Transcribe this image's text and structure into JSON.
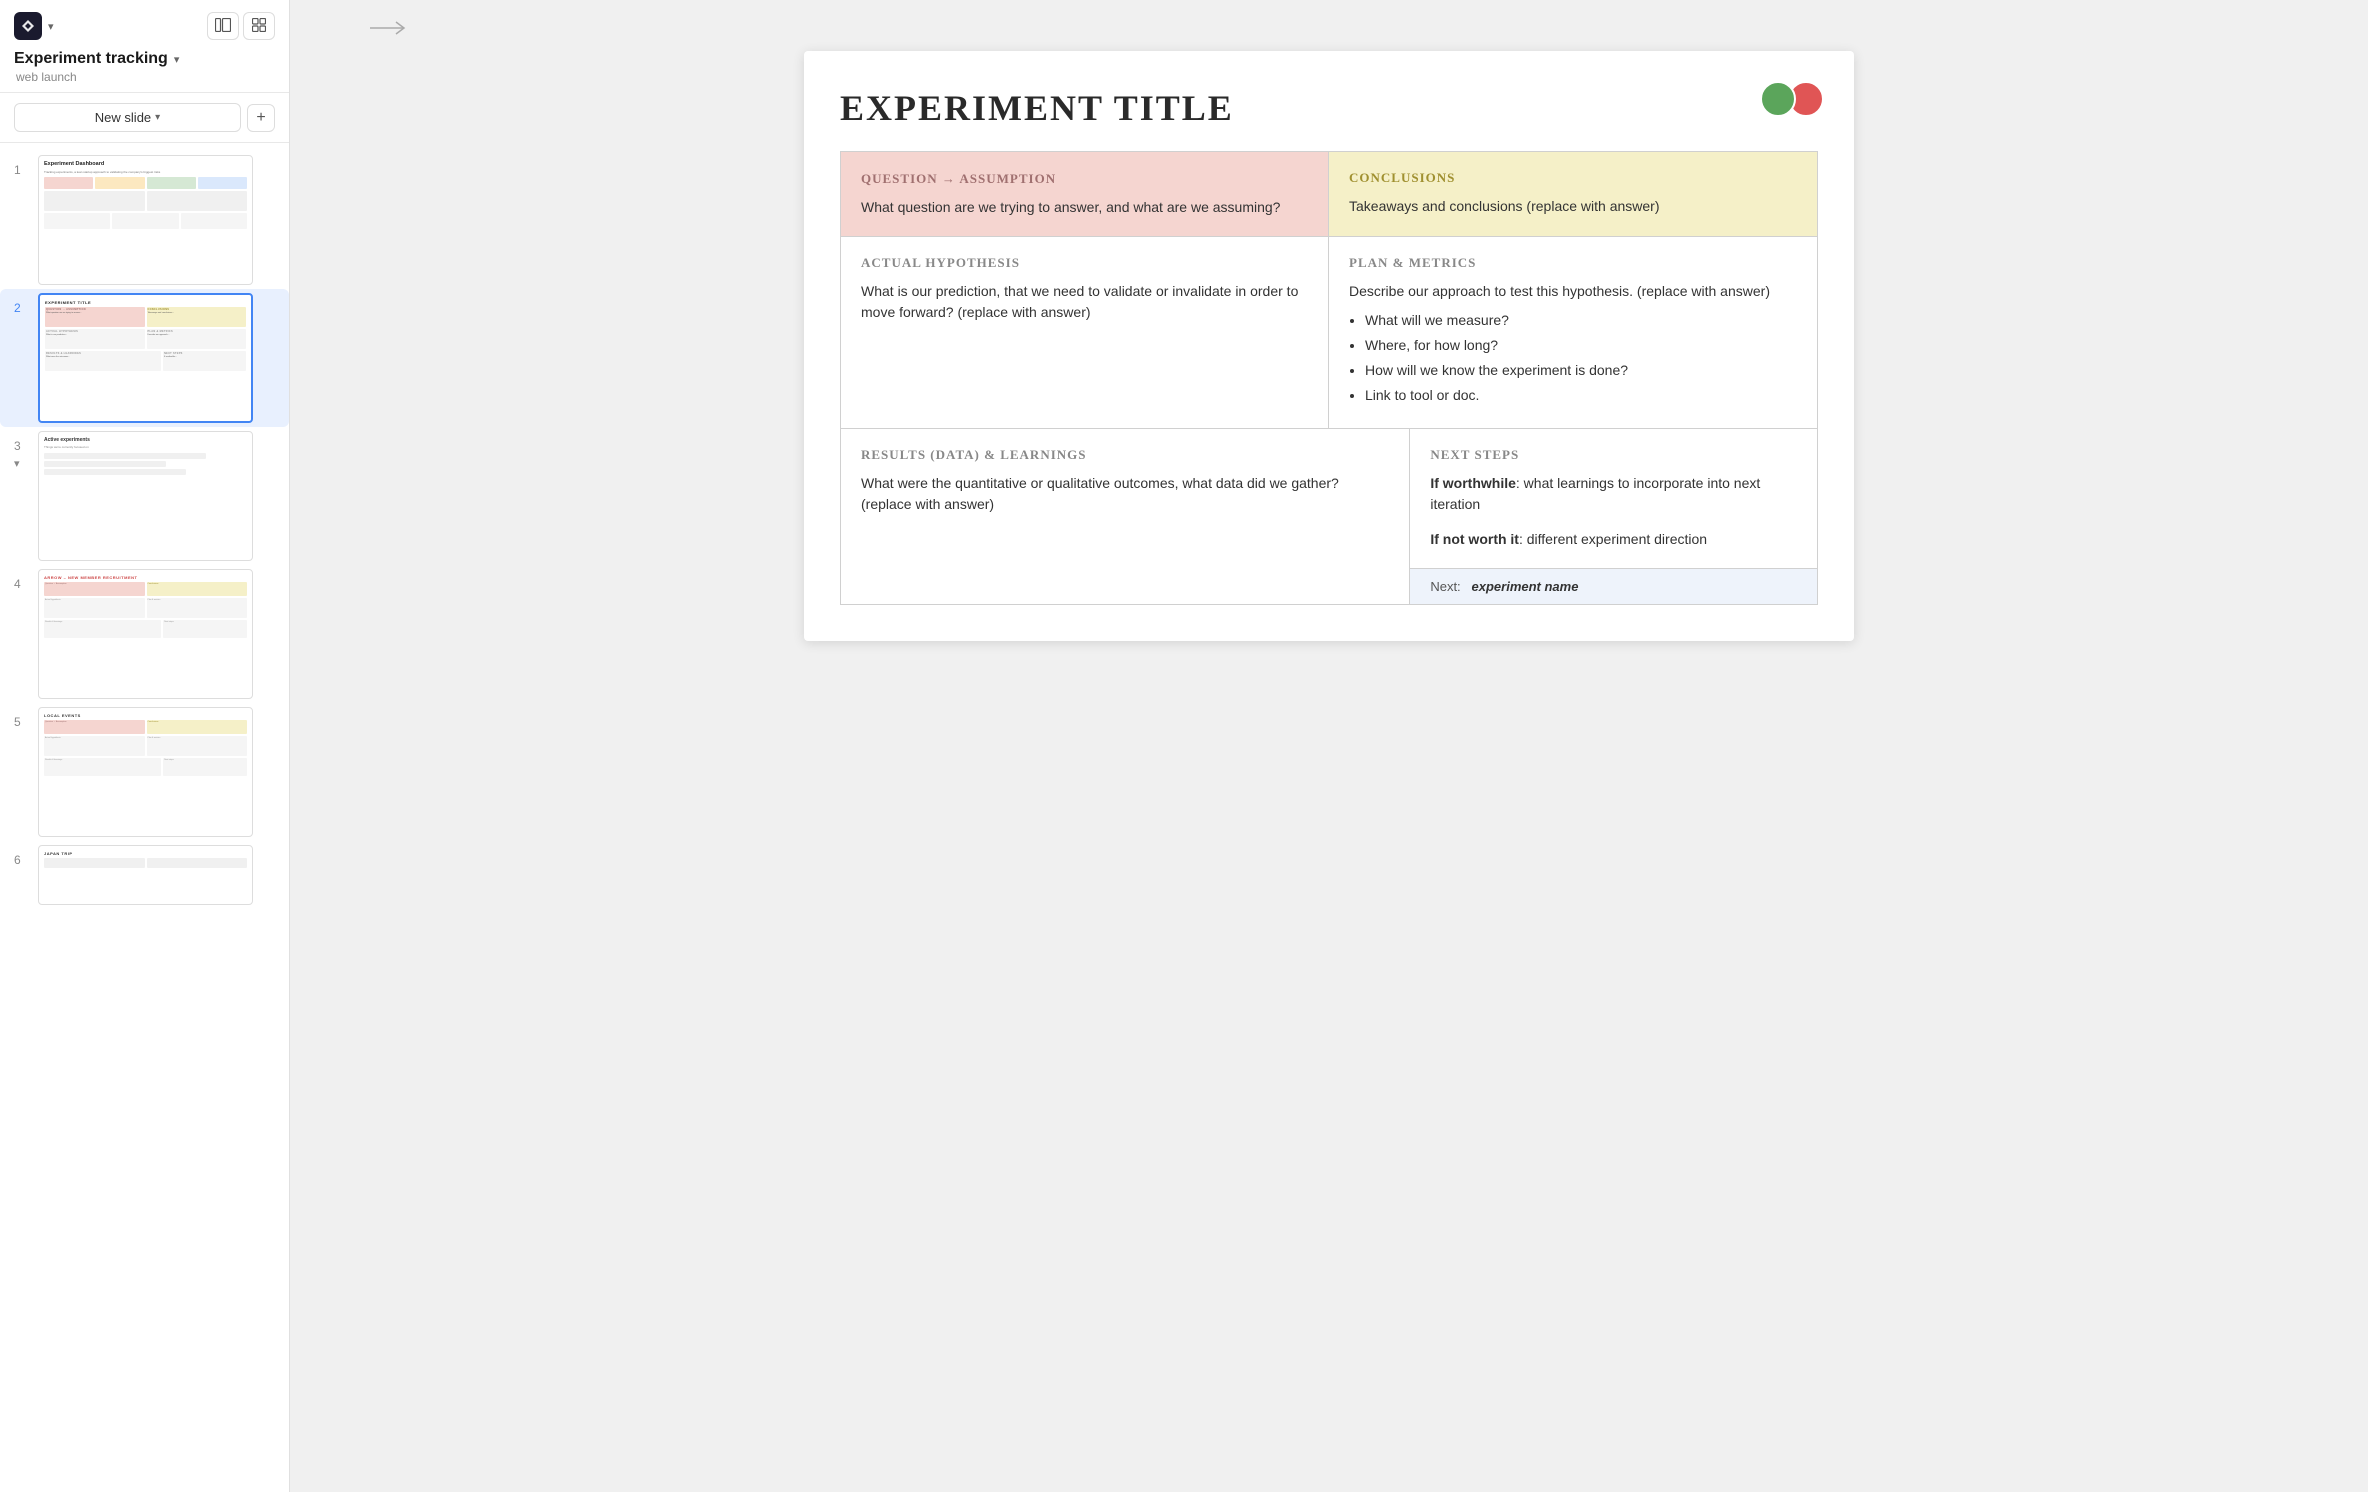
{
  "app": {
    "logo_symbol": "✦",
    "project_title": "Experiment tracking",
    "project_subtitle": "web launch",
    "new_slide_label": "New slide",
    "chevron_down": "▾",
    "add_icon": "+"
  },
  "view_toggles": {
    "panel_icon": "⊟",
    "grid_icon": "⊞"
  },
  "nav": {
    "arrow": "→"
  },
  "slides": [
    {
      "number": "1",
      "label": "Experiment Dashboard",
      "active": false
    },
    {
      "number": "2",
      "label": "Experiment title",
      "active": true
    },
    {
      "number": "3",
      "label": "Active experiments",
      "subtitle": "Things we're currently focused on",
      "active": false
    },
    {
      "number": "4",
      "label": "Arrow – new member recruitment",
      "active": false
    },
    {
      "number": "5",
      "label": "Local events",
      "active": false
    },
    {
      "number": "6",
      "label": "Japan trip",
      "active": false
    }
  ],
  "slide2": {
    "title": "Experiment title",
    "avatars": [
      {
        "color": "#5ba55b",
        "initial": ""
      },
      {
        "color": "#e05555",
        "initial": ""
      }
    ],
    "question": {
      "heading": "Question → Assumption",
      "body": "What question are we trying to answer, and what are we assuming?"
    },
    "conclusions": {
      "heading": "Conclusions",
      "body": "Takeaways and conclusions (replace with answer)"
    },
    "hypothesis": {
      "heading": "Actual hypothesis",
      "body": "What is our prediction, that we need to validate or invalidate in order to move forward? (replace with answer)"
    },
    "plan": {
      "heading": "Plan & metrics",
      "body_intro": "Describe our approach to test this hypothesis. (replace with answer)",
      "bullets": [
        "What will we measure?",
        "Where, for how long?",
        "How will we know the experiment is done?",
        "Link to tool or doc."
      ]
    },
    "results": {
      "heading": "Results (data) & learnings",
      "body": "What were the quantitative or qualitative outcomes, what data did we gather? (replace with answer)"
    },
    "nextsteps": {
      "heading": "Next steps",
      "worthwhile_label": "If worthwhile",
      "worthwhile_body": ": what learnings to incorporate into next iteration",
      "notworth_label": "If not worth it",
      "notworth_body": ": different experiment direction",
      "next_label": "Next:",
      "next_experiment": "experiment name"
    }
  }
}
